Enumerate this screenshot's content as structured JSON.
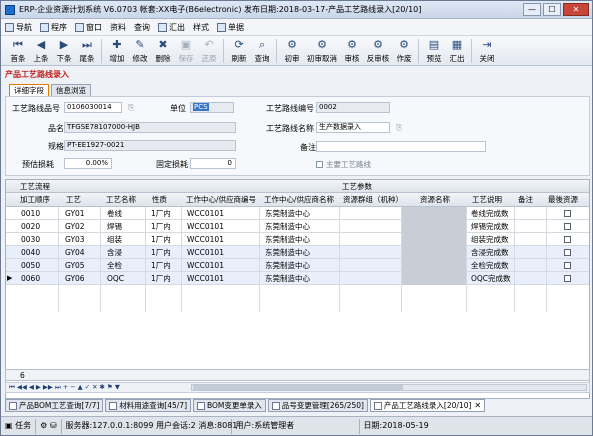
{
  "window": {
    "title": "ERP-企业资源计划系统 V6.0703 帐套:XX电子(B6electronic) 发布日期:2018-03-17-产品工艺路线录入[20/10]",
    "min": "—",
    "max": "☐",
    "close": "✕"
  },
  "menu": [
    "导航",
    "程序",
    "窗口",
    "资料",
    "查询",
    "汇出",
    "样式",
    "单据"
  ],
  "toolbar": {
    "first": "首条",
    "prev": "上条",
    "next": "下条",
    "last": "尾条",
    "add": "增加",
    "edit": "修改",
    "delete": "删除",
    "save": "保存",
    "undo": "还原",
    "refresh": "刷新",
    "query": "查询",
    "audit_init": "初审",
    "audit_init_cancel": "初审取消",
    "audit": "审核",
    "unaudit": "反审核",
    "void": "作废",
    "preview": "预览",
    "export": "汇出",
    "close": "关闭"
  },
  "page_title": "产品工艺路线录入",
  "tabs": [
    "详细字段",
    "信息浏览"
  ],
  "form": {
    "route_code_label": "工艺路线品号",
    "route_code": "0106030014",
    "unit_label": "单位",
    "unit": "PCS",
    "route_no_label": "工艺路线编号",
    "route_no": "0002",
    "name_label": "品名",
    "name": "TFGSE78107000-HJB",
    "route_name_label": "工艺路线名称",
    "route_name": "生产数据录入",
    "spec_label": "规格",
    "spec": "PT-EE1927-0021",
    "remark_label": "备注",
    "remark": "",
    "est_loss_label": "预估损耗",
    "est_loss": "0.00%",
    "fixed_loss_label": "固定损耗",
    "fixed_loss": "0",
    "main_route_label": "主要工艺路线"
  },
  "grid": {
    "group1": "工艺流程",
    "group2": "工艺参数",
    "headers": [
      "加工顺序",
      "工艺",
      "工艺名称",
      "性质",
      "工作中心/供应商编号",
      "工作中心/供应商名称",
      "资源群组（机种）",
      "资源名称",
      "工艺说明",
      "备注",
      "最後资源"
    ],
    "rows": [
      [
        "0010",
        "GY01",
        "卷线",
        "1厂内",
        "WCC0101",
        "东莞制造中心",
        "",
        "",
        "卷线完成数",
        ""
      ],
      [
        "0020",
        "GY02",
        "焊锡",
        "1厂内",
        "WCC0101",
        "东莞制造中心",
        "",
        "",
        "焊锡完成数",
        ""
      ],
      [
        "0030",
        "GY03",
        "组装",
        "1厂内",
        "WCC0101",
        "东莞制造中心",
        "",
        "",
        "组装完成数",
        ""
      ],
      [
        "0040",
        "GY04",
        "含浸",
        "1厂内",
        "WCC0101",
        "东莞制造中心",
        "",
        "",
        "含浸完成数",
        ""
      ],
      [
        "0050",
        "GY05",
        "全检",
        "1厂内",
        "WCC0101",
        "东莞制造中心",
        "",
        "",
        "全检完成数",
        ""
      ],
      [
        "0060",
        "GY06",
        "OQC",
        "1厂内",
        "WCC0101",
        "东莞制造中心",
        "",
        "",
        "OQC完成数",
        ""
      ]
    ],
    "row_count": "6"
  },
  "doc_tabs": [
    "产品BOM工艺查询[7/7]",
    "材料用途查询[45/7]",
    "BOM变更单录入",
    "品号变更管理[265/250]",
    "产品工艺路线录入[20/10]"
  ],
  "status": {
    "tasks": "任务",
    "server": "服务器:127.0.0.1:8099 用户会话:2 消息:8081",
    "user": "用户:系统管理者",
    "date": "日期:2018-05-19"
  }
}
